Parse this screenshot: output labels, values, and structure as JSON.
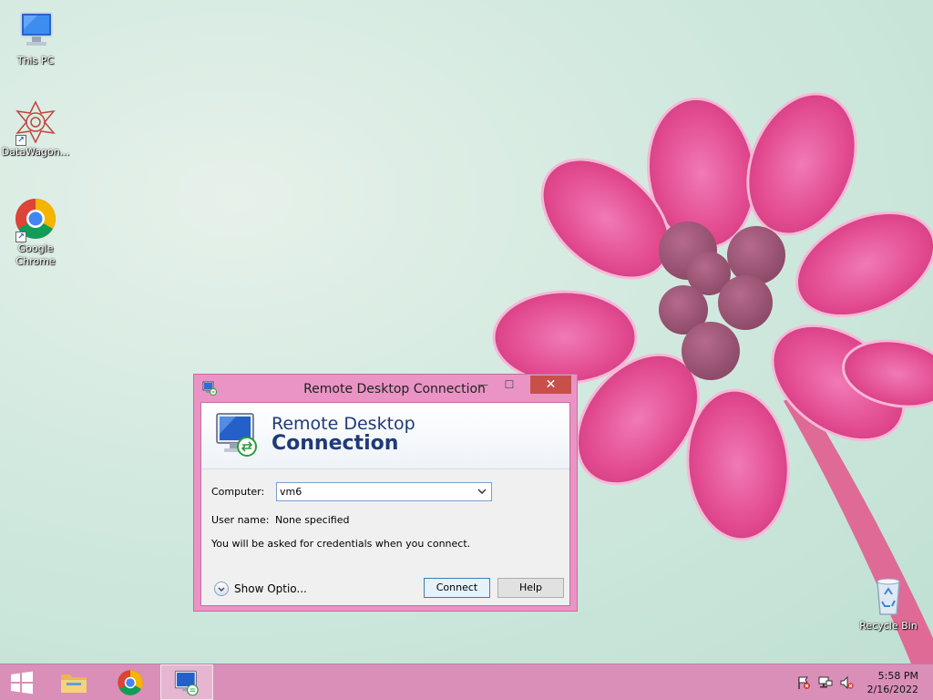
{
  "desktop": {
    "icons": [
      {
        "label": "This PC"
      },
      {
        "label": "DataWagon..."
      },
      {
        "label": "Google Chrome"
      },
      {
        "label": "Recycle Bin"
      }
    ]
  },
  "dialog": {
    "title": "Remote Desktop Connection",
    "banner_line1": "Remote Desktop",
    "banner_line2": "Connection",
    "computer_label": "Computer:",
    "computer_value": "vm6",
    "username_label": "User name:",
    "username_value": "None specified",
    "info_text": "You will be asked for credentials when you connect.",
    "show_options_label": "Show Optio...",
    "connect_label": "Connect",
    "help_label": "Help"
  },
  "taskbar": {
    "items": [
      "start",
      "file-explorer",
      "google-chrome",
      "remote-desktop-connection"
    ],
    "clock_time": "5:58 PM",
    "clock_date": "2/16/2022"
  },
  "colors": {
    "window_accent": "#e994c5",
    "close_button": "#c7504a",
    "taskbar": "#d98fb8",
    "banner_text": "#1f3a78"
  }
}
